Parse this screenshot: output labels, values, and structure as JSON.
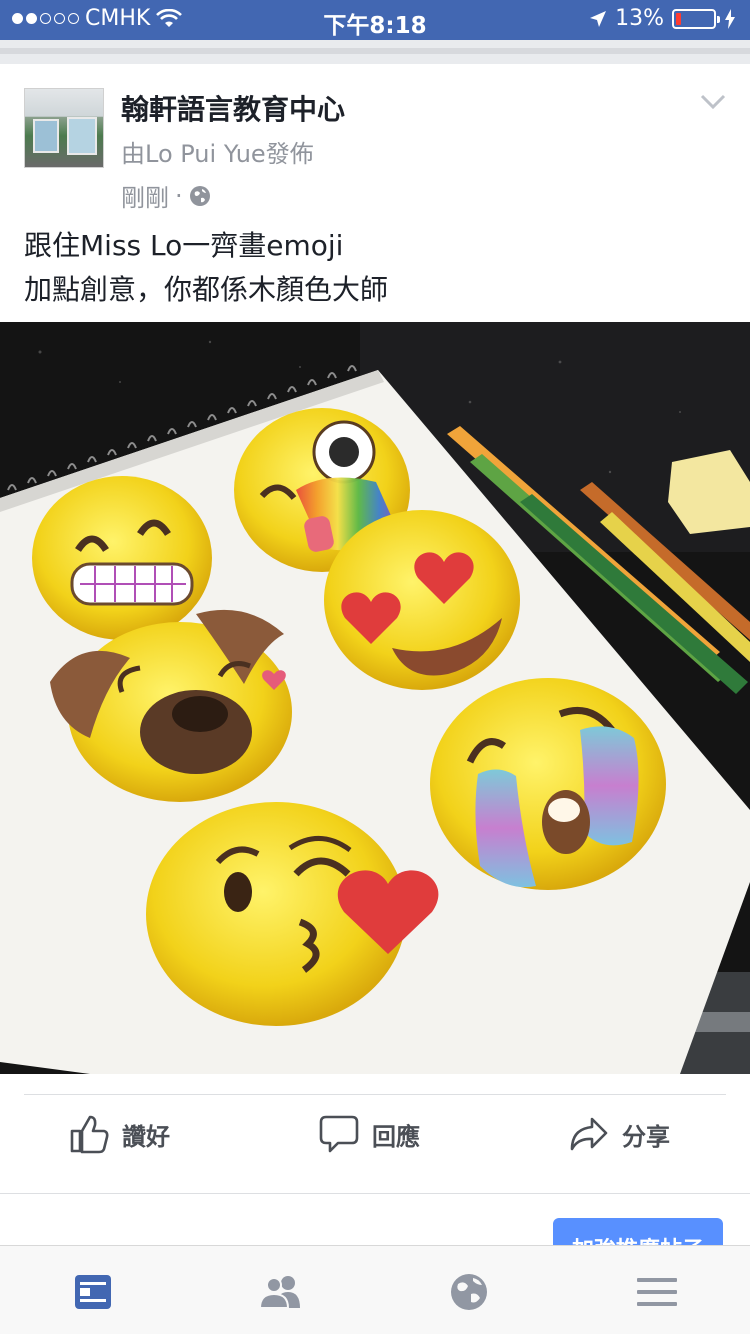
{
  "status_bar": {
    "carrier": "CMHK",
    "time": "下午8:18",
    "battery_percent_text": "13%",
    "battery_level": 0.13,
    "signal_bars_filled": 2,
    "signal_bars_total": 5
  },
  "post": {
    "page_name": "翰軒語言教育中心",
    "posted_by": "由Lo Pui Yue發佈",
    "time": "剛剛",
    "separator": "·",
    "text_lines": [
      "跟住Miss Lo一齊畫emoji",
      "加點創意，你都係木顏色大師"
    ],
    "photo_description_icon": "drawn-emoji-sketchbook-photo"
  },
  "actions": {
    "like_label": "讚好",
    "comment_label": "回應",
    "share_label": "分享"
  },
  "boost": {
    "label": "加強推廣帖子"
  },
  "tabbar": {
    "items": [
      "news-feed-icon",
      "friends-icon",
      "globe-icon",
      "menu-icon"
    ]
  },
  "colors": {
    "brand_blue": "#4267b2",
    "boost_blue": "#5890ff",
    "battery_red": "#ff3b30",
    "meta_gray": "#90949c"
  }
}
